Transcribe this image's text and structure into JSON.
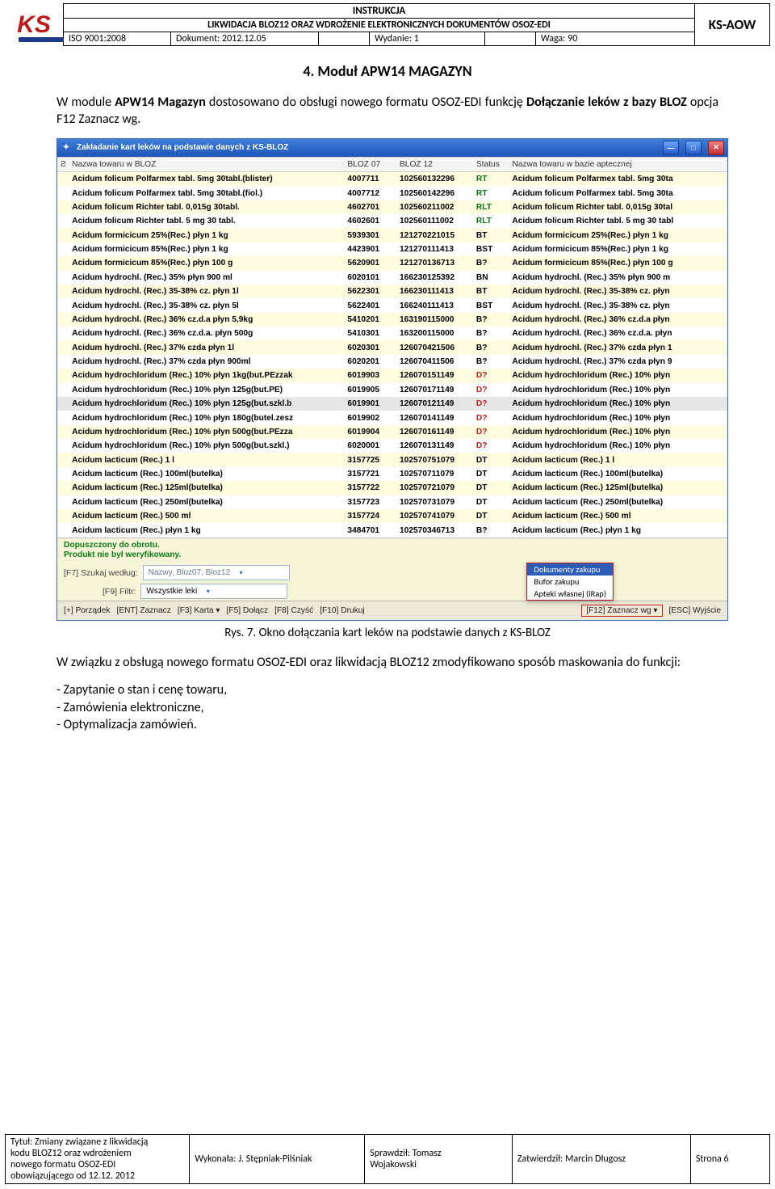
{
  "header": {
    "logo_text": "KS",
    "title": "INSTRUKCJA",
    "subtitle": "LIKWIDACJA BLOZ12 ORAZ WDROŻENIE ELEKTRONICZNYCH DOKUMENTÓW OSOZ-EDI",
    "iso": "ISO 9001:2008",
    "doc_label": "Dokument: 2012.12.05",
    "edition_label": "Wydanie: 1",
    "weight_label": "Waga: 90",
    "ksaow": "KS-AOW"
  },
  "section": {
    "title": "4. Moduł APW14 MAGAZYN",
    "para1_a": "W module ",
    "para1_b": "APW14 Magazyn",
    "para1_c": " dostosowano do obsługi nowego formatu OSOZ-EDI funkcję ",
    "para1_d": "Dołączanie leków z bazy BLOZ",
    "para1_e": " opcja F12 Zaznacz wg."
  },
  "screenshot": {
    "win_title": "Zakładanie kart leków na podstawie danych z KS-BLOZ",
    "col_idx": "Ƨ",
    "col_name": "Nazwa towaru w BLOZ",
    "col_b7": "BLOZ 07",
    "col_b12": "BLOZ 12",
    "col_st": "Status",
    "col_apt": "Nazwa towaru w bazie aptecznej",
    "rows": [
      {
        "n": "Acidum folicum Polfarmex tabl. 5mg 30tabl.(blister)",
        "b7": "4007711",
        "b12": "102560132296",
        "st": "RT",
        "stc": "g",
        "apt": "Acidum folicum Polfarmex tabl. 5mg 30ta",
        "cls": "y"
      },
      {
        "n": "Acidum folicum Polfarmex tabl. 5mg 30tabl.(fiol.)",
        "b7": "4007712",
        "b12": "102560142296",
        "st": "RT",
        "stc": "g",
        "apt": "Acidum folicum Polfarmex tabl. 5mg 30ta",
        "cls": "w"
      },
      {
        "n": "Acidum folicum Richter tabl. 0,015g 30tabl.",
        "b7": "4602701",
        "b12": "102560211002",
        "st": "RLT",
        "stc": "g",
        "apt": "Acidum folicum Richter tabl. 0,015g 30tal",
        "cls": "y"
      },
      {
        "n": "Acidum folicum Richter tabl. 5 mg 30 tabl.",
        "b7": "4602601",
        "b12": "102560111002",
        "st": "RLT",
        "stc": "g",
        "apt": "Acidum folicum Richter tabl. 5 mg 30 tabl",
        "cls": "w"
      },
      {
        "n": "Acidum formicicum 25%(Rec.) płyn 1 kg",
        "b7": "5939301",
        "b12": "121270221015",
        "st": "BT",
        "stc": "",
        "apt": "Acidum formicicum 25%(Rec.) płyn 1 kg",
        "cls": "y"
      },
      {
        "n": "Acidum formicicum 85%(Rec.) płyn 1 kg",
        "b7": "4423901",
        "b12": "121270111413",
        "st": "BST",
        "stc": "",
        "apt": "Acidum formicicum 85%(Rec.) płyn 1 kg",
        "cls": "w"
      },
      {
        "n": "Acidum formicicum 85%(Rec.) płyn 100 g",
        "b7": "5620901",
        "b12": "121270136713",
        "st": "B?",
        "stc": "",
        "apt": "Acidum formicicum 85%(Rec.) płyn 100 g",
        "cls": "y"
      },
      {
        "n": "Acidum hydrochl. (Rec.) 35% płyn 900 ml",
        "b7": "6020101",
        "b12": "166230125392",
        "st": "BN",
        "stc": "",
        "apt": "Acidum hydrochl. (Rec.) 35% płyn 900 m",
        "cls": "w"
      },
      {
        "n": "Acidum hydrochl. (Rec.) 35-38% cz. płyn 1l",
        "b7": "5622301",
        "b12": "166230111413",
        "st": "BT",
        "stc": "",
        "apt": "Acidum hydrochl. (Rec.) 35-38% cz. płyn",
        "cls": "y"
      },
      {
        "n": "Acidum hydrochl. (Rec.) 35-38% cz. płyn 5l",
        "b7": "5622401",
        "b12": "166240111413",
        "st": "BST",
        "stc": "",
        "apt": "Acidum hydrochl. (Rec.) 35-38% cz. płyn",
        "cls": "w"
      },
      {
        "n": "Acidum hydrochl. (Rec.) 36% cz.d.a płyn 5,9kg",
        "b7": "5410201",
        "b12": "163190115000",
        "st": "B?",
        "stc": "",
        "apt": "Acidum hydrochl. (Rec.) 36% cz.d.a płyn",
        "cls": "y"
      },
      {
        "n": "Acidum hydrochl. (Rec.) 36% cz.d.a. płyn 500g",
        "b7": "5410301",
        "b12": "163200115000",
        "st": "B?",
        "stc": "",
        "apt": "Acidum hydrochl. (Rec.) 36% cz.d.a. płyn",
        "cls": "w"
      },
      {
        "n": "Acidum hydrochl. (Rec.) 37% czda płyn 1l",
        "b7": "6020301",
        "b12": "126070421506",
        "st": "B?",
        "stc": "",
        "apt": "Acidum hydrochl. (Rec.) 37% czda płyn 1",
        "cls": "y"
      },
      {
        "n": "Acidum hydrochl. (Rec.) 37% czda płyn 900ml",
        "b7": "6020201",
        "b12": "126070411506",
        "st": "B?",
        "stc": "",
        "apt": "Acidum hydrochl. (Rec.) 37% czda płyn 9",
        "cls": "w"
      },
      {
        "n": "Acidum hydrochloridum (Rec.) 10% płyn 1kg(but.PEzzak",
        "b7": "6019903",
        "b12": "126070151149",
        "st": "D?",
        "stc": "r",
        "apt": "Acidum hydrochloridum (Rec.) 10% płyn",
        "cls": "y"
      },
      {
        "n": "Acidum hydrochloridum (Rec.) 10% płyn 125g(but.PE)",
        "b7": "6019905",
        "b12": "126070171149",
        "st": "D?",
        "stc": "r",
        "apt": "Acidum hydrochloridum (Rec.) 10% płyn",
        "cls": "w"
      },
      {
        "n": "Acidum hydrochloridum (Rec.) 10% płyn 125g(but.szkl.b",
        "b7": "6019901",
        "b12": "126070121149",
        "st": "D?",
        "stc": "r",
        "apt": "Acidum hydrochloridum (Rec.) 10% płyn",
        "cls": "sel"
      },
      {
        "n": "Acidum hydrochloridum (Rec.) 10% płyn 180g(butel.zesz",
        "b7": "6019902",
        "b12": "126070141149",
        "st": "D?",
        "stc": "r",
        "apt": "Acidum hydrochloridum (Rec.) 10% płyn",
        "cls": "w"
      },
      {
        "n": "Acidum hydrochloridum (Rec.) 10% płyn 500g(but.PEzza",
        "b7": "6019904",
        "b12": "126070161149",
        "st": "D?",
        "stc": "r",
        "apt": "Acidum hydrochloridum (Rec.) 10% płyn",
        "cls": "y"
      },
      {
        "n": "Acidum hydrochloridum (Rec.) 10% płyn 500g(but.szkl.)",
        "b7": "6020001",
        "b12": "126070131149",
        "st": "D?",
        "stc": "r",
        "apt": "Acidum hydrochloridum (Rec.) 10% płyn",
        "cls": "w"
      },
      {
        "n": "Acidum lacticum (Rec.) 1 l",
        "b7": "3157725",
        "b12": "102570751079",
        "st": "DT",
        "stc": "",
        "apt": "Acidum lacticum (Rec.) 1 l",
        "cls": "y"
      },
      {
        "n": "Acidum lacticum (Rec.) 100ml(butelka)",
        "b7": "3157721",
        "b12": "102570711079",
        "st": "DT",
        "stc": "",
        "apt": "Acidum lacticum (Rec.) 100ml(butelka)",
        "cls": "w"
      },
      {
        "n": "Acidum lacticum (Rec.) 125ml(butelka)",
        "b7": "3157722",
        "b12": "102570721079",
        "st": "DT",
        "stc": "",
        "apt": "Acidum lacticum (Rec.) 125ml(butelka)",
        "cls": "y"
      },
      {
        "n": "Acidum lacticum (Rec.) 250ml(butelka)",
        "b7": "3157723",
        "b12": "102570731079",
        "st": "DT",
        "stc": "",
        "apt": "Acidum lacticum (Rec.) 250ml(butelka)",
        "cls": "w"
      },
      {
        "n": "Acidum lacticum (Rec.) 500 ml",
        "b7": "3157724",
        "b12": "102570741079",
        "st": "DT",
        "stc": "",
        "apt": "Acidum lacticum (Rec.) 500 ml",
        "cls": "y"
      },
      {
        "n": "Acidum lacticum (Rec.) płyn 1 kg",
        "b7": "3484701",
        "b12": "102570346713",
        "st": "B?",
        "stc": "",
        "apt": "Acidum lacticum (Rec.) płyn 1 kg",
        "cls": "w"
      }
    ],
    "msg_line1": "Dopuszczony do obrotu.",
    "msg_line2": "Produkt nie był weryfikowany.",
    "search_label": "[F7] Szukaj według:",
    "search_placeholder": "Nazwy, Bloz07, Bloz12",
    "filter_label": "[F9] Filtr:",
    "filter_value": "Wszystkie leki",
    "popup": {
      "i1": "Dokumenty zakupu",
      "i2": "Bufor zakupu",
      "i3": "Apteki własnej (iRap)"
    },
    "bottom": {
      "b1": "[+] Porządek",
      "b2": "[ENT] Zaznacz",
      "b3": "[F3] Karta ▾",
      "b4": "[F5] Dołącz",
      "b5": "[F8] Czyść",
      "b6": "[F10] Drukuj",
      "b7": "[F12] Zaznacz wg ▾",
      "b8": "[ESC] Wyjście"
    }
  },
  "caption": "Rys. 7. Okno dołączania kart leków na podstawie danych z KS-BLOZ",
  "post": {
    "para": "W związku z obsługą nowego formatu OSOZ-EDI oraz likwidacją BLOZ12 zmodyfikowano sposób maskowania do funkcji:",
    "i1": "- Zapytanie o stan i cenę towaru,",
    "i2": "- Zamówienia elektroniczne,",
    "i3": "- Optymalizacja zamówień."
  },
  "footer": {
    "c1a": "Tytuł:  Zmiany związane z likwidacją",
    "c1b": "kodu BLOZ12 oraz wdrożeniem",
    "c1c": "nowego formatu OSOZ-EDI",
    "c1d": "obowiązującego od 12.12. 2012",
    "c2": "Wykonała: J. Stępniak-Pilśniak",
    "c3a": "Sprawdził: Tomasz",
    "c3b": "Wojakowski",
    "c4": "Zatwierdził: Marcin Długosz",
    "c5": "Strona 6"
  }
}
